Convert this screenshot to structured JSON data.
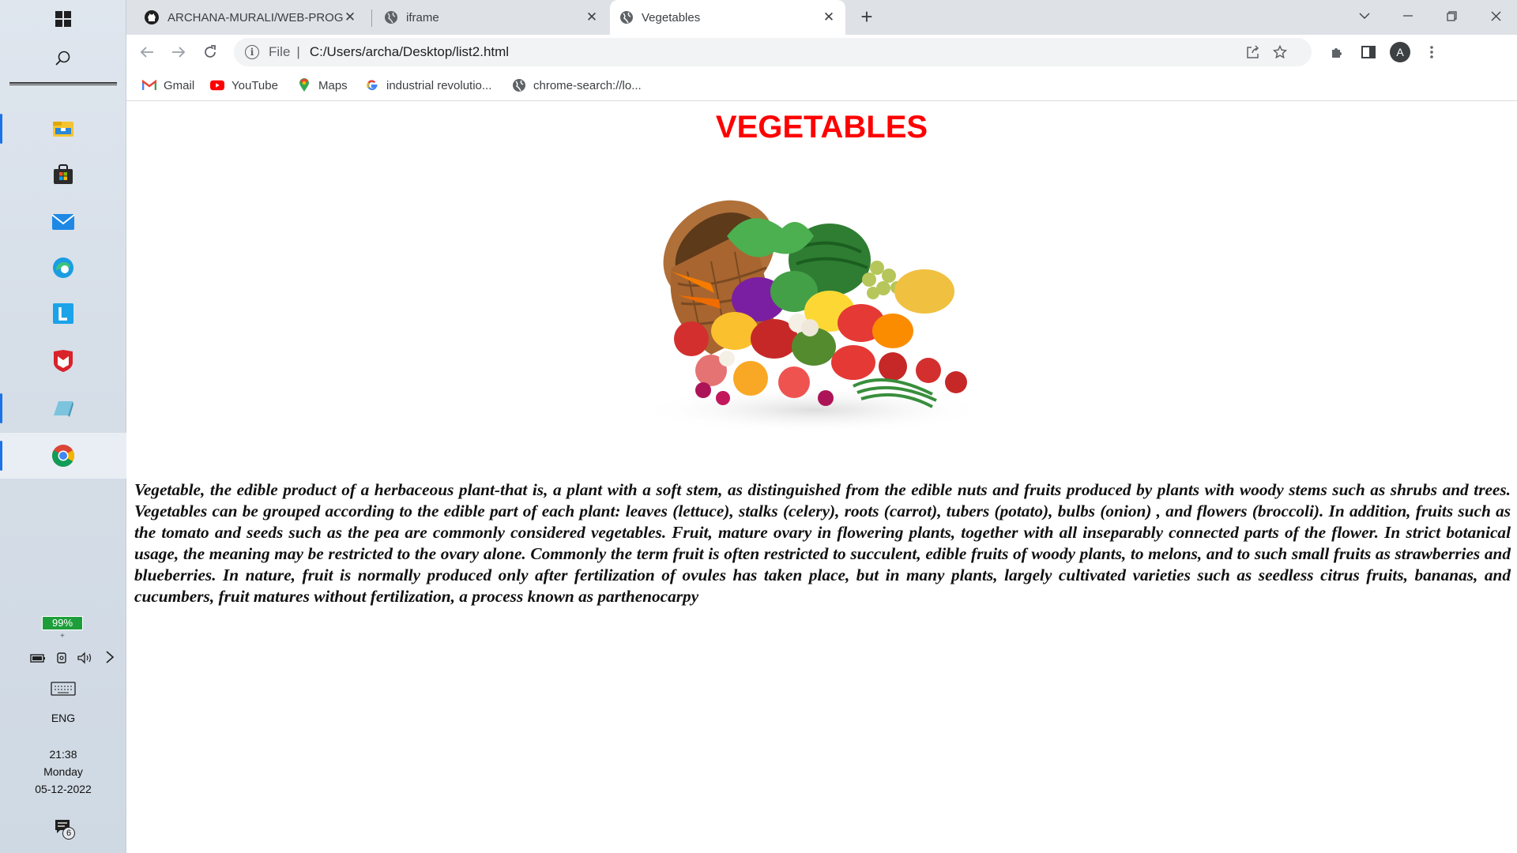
{
  "taskbar": {
    "battery_percent": "99%",
    "language": "ENG",
    "time": "21:38",
    "day": "Monday",
    "date": "05-12-2022",
    "notification_count": "6",
    "icons": [
      "windows-start-icon",
      "search-icon",
      "file-explorer-icon",
      "microsoft-store-icon",
      "mail-icon",
      "edge-icon",
      "l-app-icon",
      "mcafee-icon",
      "paint-3d-icon",
      "chrome-icon"
    ]
  },
  "browser": {
    "tabs": [
      {
        "title": "ARCHANA-MURALI/WEB-PROGR",
        "icon": "github-icon",
        "active": false
      },
      {
        "title": "iframe",
        "icon": "globe-icon",
        "active": false
      },
      {
        "title": "Vegetables",
        "icon": "globe-icon",
        "active": true
      }
    ],
    "new_tab_label": "+",
    "omnibox": {
      "scheme": "File",
      "url": "C:/Users/archa/Desktop/list2.html"
    },
    "profile_initial": "A",
    "bookmarks": [
      {
        "label": "Gmail",
        "icon": "gmail-icon"
      },
      {
        "label": "YouTube",
        "icon": "youtube-icon"
      },
      {
        "label": "Maps",
        "icon": "maps-icon"
      },
      {
        "label": "industrial revolutio...",
        "icon": "google-icon"
      },
      {
        "label": "chrome-search://lo...",
        "icon": "globe-icon"
      }
    ]
  },
  "page": {
    "heading": "VEGETABLES",
    "heading_color": "#ff0000",
    "image_alt": "basket of vegetables",
    "description": "Vegetable, the edible product of a herbaceous plant-that is, a plant with a soft stem, as distinguished from the edible nuts and fruits produced by plants with woody stems such as shrubs and trees. Vegetables can be grouped according to the edible part of each plant: leaves (lettuce), stalks (celery), roots (carrot), tubers (potato), bulbs (onion) , and flowers (broccoli). In addition, fruits such as the tomato and seeds such as the pea are commonly considered vegetables. Fruit, mature ovary in flowering plants, together with all inseparably connected parts of the flower. In strict botanical usage, the meaning may be restricted to the ovary alone. Commonly the term fruit is often restricted to succulent, edible fruits of woody plants, to melons, and to such small fruits as strawberries and blueberries. In nature, fruit is normally produced only after fertilization of ovules has taken place, but in many plants, largely cultivated varieties such as seedless citrus fruits, bananas, and cucumbers, fruit matures without fertilization, a process known as parthenocarpy"
  }
}
